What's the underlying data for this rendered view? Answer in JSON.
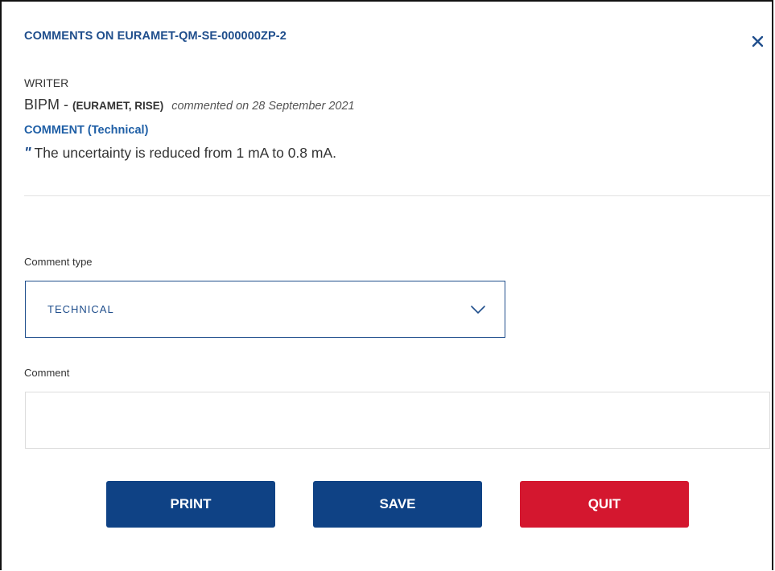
{
  "dialog": {
    "title": "COMMENTS ON EURAMET-QM-SE-000000ZP-2",
    "close_icon": "close-icon",
    "colors": {
      "primary": "#0f4285",
      "danger": "#d4172f",
      "link": "#1f5fa6"
    }
  },
  "writer": {
    "label": "WRITER",
    "name": "BIPM",
    "separator": " - ",
    "orgs": "(EURAMET, RISE)",
    "date_text": "commented on 28 September 2021"
  },
  "comment": {
    "label": "COMMENT (Technical)",
    "quote_mark": "\"",
    "text": "The uncertainty is reduced from 1 mA to 0.8 mA."
  },
  "form": {
    "type_label": "Comment type",
    "type_value": "TECHNICAL",
    "dropdown_icon": "chevron-down-icon",
    "comment_label": "Comment",
    "comment_value": ""
  },
  "buttons": {
    "print": "PRINT",
    "save": "SAVE",
    "quit": "QUIT"
  }
}
